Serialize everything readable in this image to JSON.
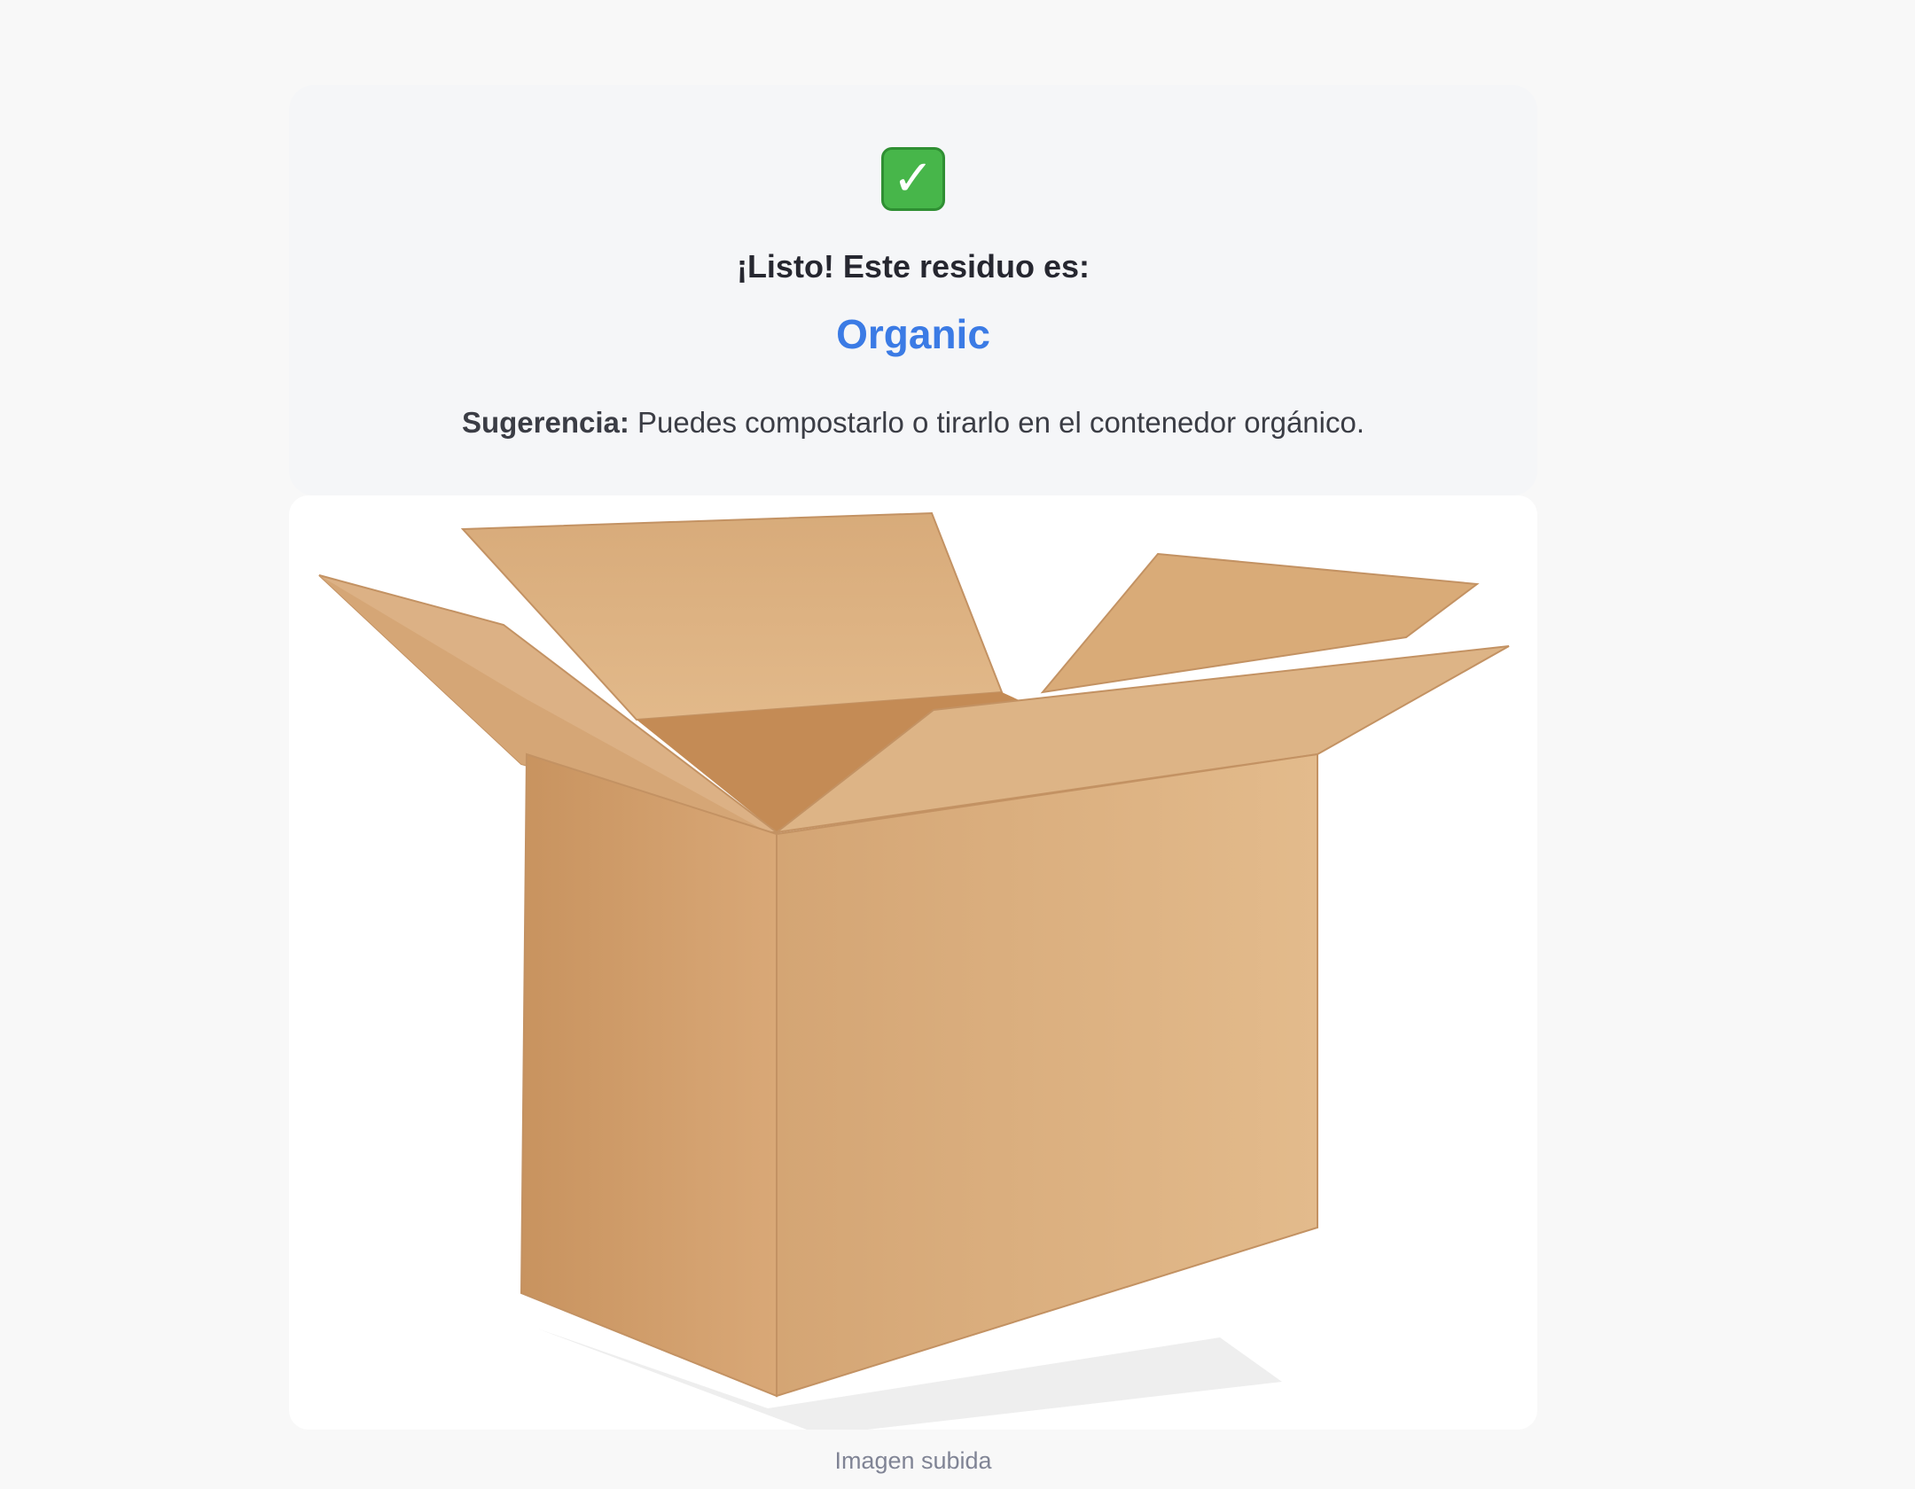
{
  "result": {
    "icon": "check-mark-icon",
    "heading": "¡Listo! Este residuo es:",
    "category": "Organic",
    "category_color": "#3b7be5",
    "suggestion_label": "Sugerencia:",
    "suggestion_text": " Puedes compostarlo o tirarlo en el contenedor orgánico."
  },
  "uploaded_image": {
    "subject": "cardboard-box-image",
    "caption": "Imagen subida"
  }
}
